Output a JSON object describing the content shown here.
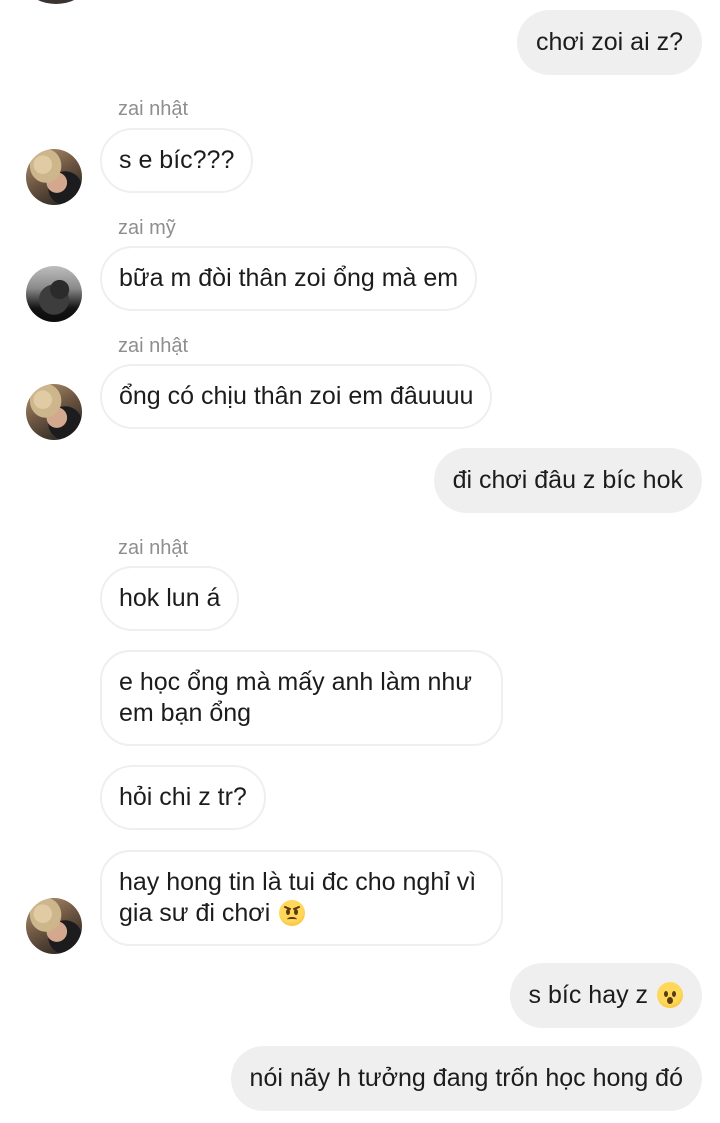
{
  "conversation": {
    "messages": [
      {
        "direction": "outgoing",
        "text": "chơi zoi ai z?"
      },
      {
        "direction": "incoming",
        "sender": "zai nhật",
        "text": "s e bíc???"
      },
      {
        "direction": "incoming",
        "sender": "zai mỹ",
        "text": "bữa m đòi thân zoi ổng mà em"
      },
      {
        "direction": "incoming",
        "sender": "zai nhật",
        "text": "ổng có chịu thân zoi em đâuuuu"
      },
      {
        "direction": "outgoing",
        "text": "đi chơi đâu z bíc hok"
      },
      {
        "direction": "incoming",
        "sender": "zai nhật",
        "text": "hok lun á"
      },
      {
        "direction": "incoming",
        "text": "e học ổng mà mấy anh làm như em bạn ổng"
      },
      {
        "direction": "incoming",
        "text": "hỏi chi z tr?"
      },
      {
        "direction": "incoming",
        "text": "hay hong tin là tui đc cho nghỉ vì gia sư đi chơi",
        "emoji": "angry-face-emoji"
      },
      {
        "direction": "outgoing",
        "text": "s bíc hay z",
        "emoji": "hushed-face-emoji"
      },
      {
        "direction": "outgoing",
        "text": "nói nãy h tưởng đang trốn học hong đó"
      }
    ]
  },
  "colors": {
    "outgoing_bubble": "#efefef",
    "incoming_border": "#efefef",
    "sender_label": "#8e8e8e",
    "text": "#1c1c1c"
  }
}
